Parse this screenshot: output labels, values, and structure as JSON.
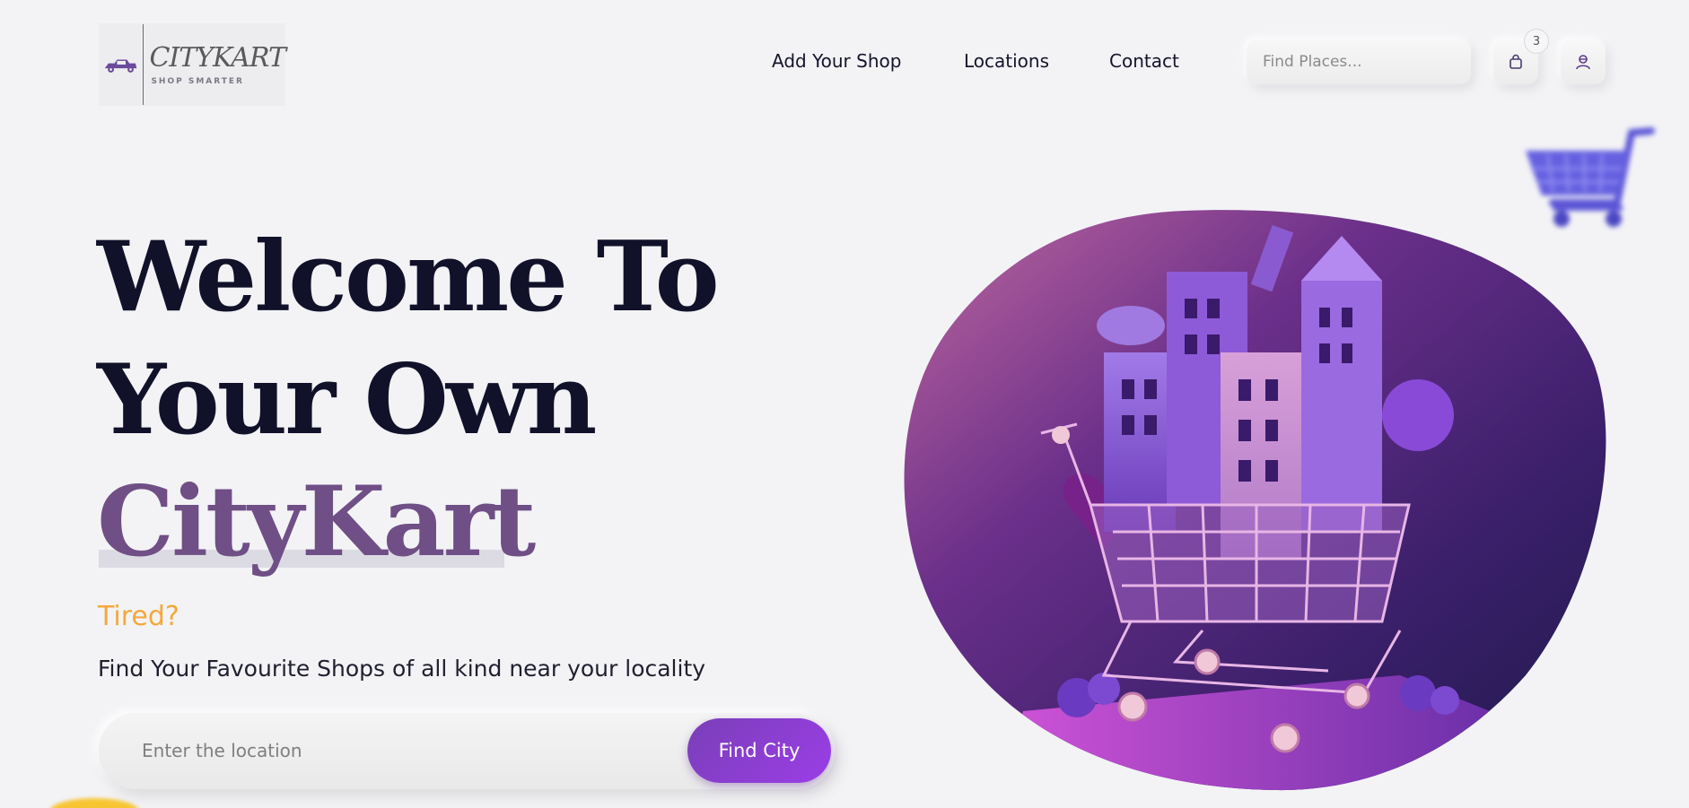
{
  "logo": {
    "title": "CITYKART",
    "subtitle": "SHOP SMARTER",
    "icon": "vehicle-logo-icon"
  },
  "nav": {
    "items": [
      {
        "label": "Add Your Shop"
      },
      {
        "label": "Locations"
      },
      {
        "label": "Contact"
      }
    ]
  },
  "search": {
    "placeholder": "Find Places...",
    "icon": "search-icon"
  },
  "cart": {
    "icon": "shopping-bag-icon",
    "count": "3"
  },
  "user": {
    "icon": "user-icon"
  },
  "hero": {
    "line1": "Welcome To",
    "line2": "Your Own",
    "line3": "CityKart",
    "tired": "Tired?",
    "tagline": "Find Your Favourite Shops of all kind near your locality"
  },
  "location": {
    "placeholder": "Enter the location",
    "button": "Find City"
  },
  "colors": {
    "background": "#f3f3f6",
    "accent": "#6f4f86",
    "highlight": "#f4a83a",
    "button": "#8a3fd0"
  }
}
